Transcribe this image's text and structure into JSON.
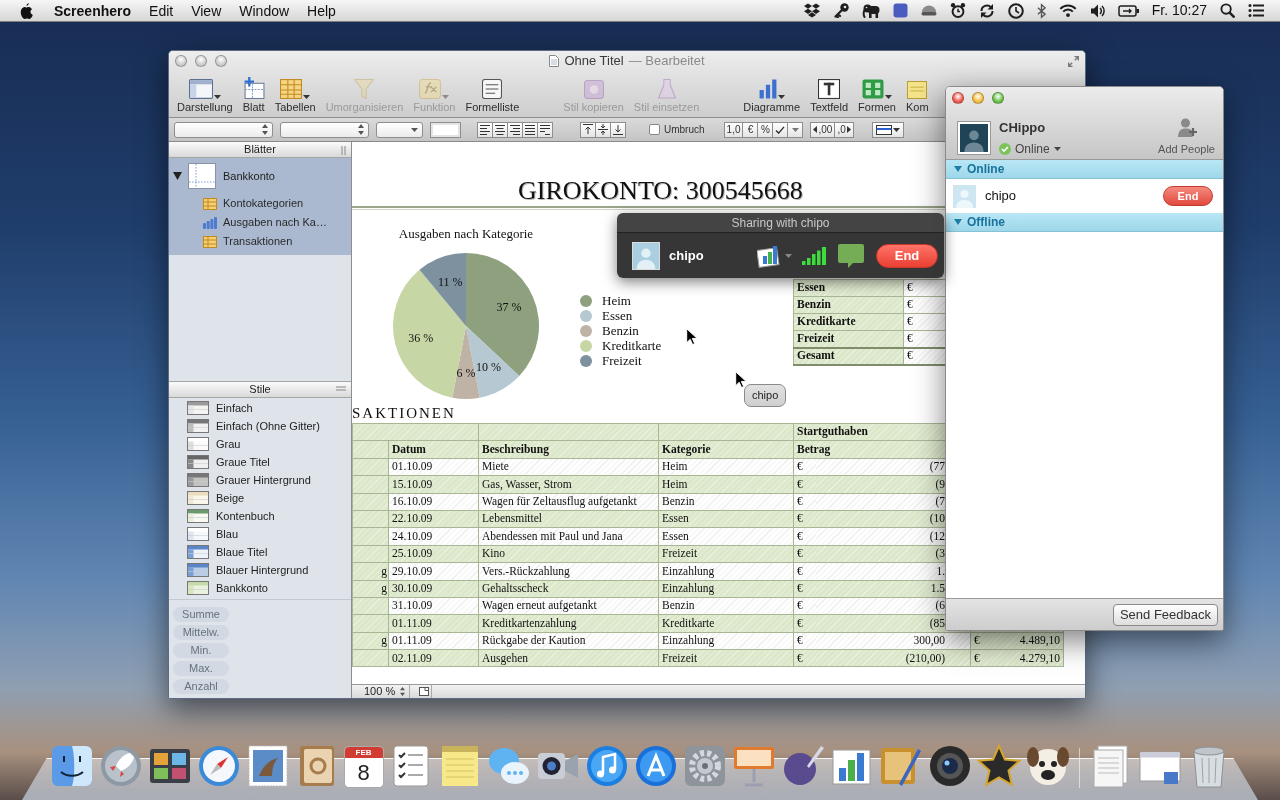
{
  "menu_bar": {
    "app": "Screenhero",
    "menus": [
      "Edit",
      "View",
      "Window",
      "Help"
    ],
    "clock": "Fr. 10:27"
  },
  "numbers_window": {
    "focused": false,
    "title": "Ohne Titel",
    "status": "— Bearbeitet",
    "toolbar": [
      {
        "kind": "view",
        "label": "Darstellung",
        "disabled": false,
        "menu": true
      },
      {
        "kind": "sheet",
        "label": "Blatt",
        "disabled": false,
        "menu": false
      },
      {
        "kind": "tables",
        "label": "Tabellen",
        "disabled": false,
        "menu": true
      },
      {
        "kind": "reorganize",
        "label": "Umorganisieren",
        "disabled": true,
        "menu": false
      },
      {
        "kind": "function",
        "label": "Funktion",
        "disabled": true,
        "menu": true
      },
      {
        "kind": "formula_list",
        "label": "Formelliste",
        "disabled": false,
        "menu": false
      },
      {
        "kind": "copy_style",
        "label": "Stil kopieren",
        "disabled": true,
        "menu": false
      },
      {
        "kind": "paste_style",
        "label": "Stil einsetzen",
        "disabled": true,
        "menu": false
      },
      {
        "kind": "charts",
        "label": "Diagramme",
        "disabled": false,
        "menu": true
      },
      {
        "kind": "textbox",
        "label": "Textfeld",
        "disabled": false,
        "menu": false
      },
      {
        "kind": "shapes",
        "label": "Formen",
        "disabled": false,
        "menu": true
      },
      {
        "kind": "comment",
        "label": "Kom",
        "disabled": false,
        "menu": false
      }
    ],
    "format_bar": {
      "wrap": {
        "label": "Umbruch",
        "checked": false
      },
      "number_formats": [
        "1,0",
        "€",
        "%"
      ],
      "decimals": [
        {
          "kind": "decrease",
          "label": ",00"
        },
        {
          "kind": "increase",
          "label": ",0"
        }
      ]
    },
    "sidebar": {
      "sheets_title": "Blätter",
      "sheets": [
        {
          "label": "Bankkonto",
          "selected": true,
          "expanded": true,
          "children": [
            {
              "kind": "table",
              "label": "Kontokategorien"
            },
            {
              "kind": "chart",
              "label": "Ausgaben nach Ka…"
            },
            {
              "kind": "table",
              "label": "Transaktionen"
            }
          ]
        }
      ],
      "styles_title": "Stile",
      "styles": [
        "Einfach",
        "Einfach (Ohne Gitter)",
        "Grau",
        "Graue Titel",
        "Grauer Hintergrund",
        "Beige",
        "Kontenbuch",
        "Blau",
        "Blaue Titel",
        "Blauer Hintergrund",
        "Bankkonto"
      ],
      "quick_formulas": [
        {
          "label": "Summe",
          "disabled": true
        },
        {
          "label": "Mittelw.",
          "disabled": true
        },
        {
          "label": "Min.",
          "disabled": true
        },
        {
          "label": "Max.",
          "disabled": true
        },
        {
          "label": "Anzahl",
          "disabled": true
        }
      ]
    },
    "canvas": {
      "title": "GIROKONTO: 300545668",
      "chart_data": {
        "type": "pie",
        "title": "Ausgaben nach Kategorie",
        "categories": [
          "Heim",
          "Essen",
          "Benzin",
          "Kreditkarte",
          "Freizeit"
        ],
        "values": [
          37,
          10,
          6,
          36,
          11
        ],
        "value_labels": [
          "37 %",
          "10 %",
          "6 %",
          "36 %",
          "11 %"
        ],
        "colors": [
          "#8ea07e",
          "#b6c8d1",
          "#bfb3a6",
          "#c7d6a5",
          "#7d919f"
        ],
        "legend": "right"
      },
      "categories_table": {
        "rows": [
          {
            "kind": "item",
            "label": "Essen",
            "currency": "€"
          },
          {
            "kind": "item",
            "label": "Benzin",
            "currency": "€"
          },
          {
            "kind": "item",
            "label": "Kreditkarte",
            "currency": "€"
          },
          {
            "kind": "item",
            "label": "Freizeit",
            "currency": "€"
          },
          {
            "kind": "total",
            "label": "Gesamt",
            "currency": "€"
          }
        ]
      },
      "transactions": {
        "title": "SAKTIONEN",
        "group_header": "Startguthaben",
        "columns": [
          "Datum",
          "Beschreibung",
          "Kategorie",
          "Betrag"
        ],
        "rows": [
          {
            "date": "01.10.09",
            "description": "Miete",
            "category": "Heim",
            "currency": "€",
            "amount": "(77"
          },
          {
            "date": "15.10.09",
            "description": "Gas, Wasser, Strom",
            "category": "Heim",
            "currency": "€",
            "amount": "(9"
          },
          {
            "date": "16.10.09",
            "description": "Wagen für Zeltausflug aufgetankt",
            "category": "Benzin",
            "currency": "€",
            "amount": "(7"
          },
          {
            "date": "22.10.09",
            "description": "Lebensmittel",
            "category": "Essen",
            "currency": "€",
            "amount": "(10"
          },
          {
            "date": "24.10.09",
            "description": "Abendessen mit Paul und Jana",
            "category": "Essen",
            "currency": "€",
            "amount": "(12"
          },
          {
            "date": "25.10.09",
            "description": "Kino",
            "category": "Freizeit",
            "currency": "€",
            "amount": "(3"
          },
          {
            "column_1": "g",
            "date": "29.10.09",
            "description": "Vers.-Rückzahlung",
            "category": "Einzahlung",
            "currency": "€",
            "amount": "1."
          },
          {
            "column_1": "g",
            "date": "30.10.09",
            "description": "Gehaltsscheck",
            "category": "Einzahlung",
            "currency": "€",
            "amount": "1.5"
          },
          {
            "date": "31.10.09",
            "description": "Wagen erneut aufgetankt",
            "category": "Benzin",
            "currency": "€",
            "amount": "(6"
          },
          {
            "date": "01.11.09",
            "description": "Kreditkartenzahlung",
            "category": "Kreditkarte",
            "currency": "€",
            "amount": "(85"
          },
          {
            "column_1": "g",
            "date": "01.11.09",
            "description": "Rückgabe der Kaution",
            "category": "Einzahlung",
            "currency": "€",
            "amount": "300,00",
            "balance_currency": "€",
            "balance": "4.489,10"
          },
          {
            "date": "02.11.09",
            "description": "Ausgehen",
            "category": "Freizeit",
            "currency": "€",
            "amount": "(210,00)",
            "balance_currency": "€",
            "balance": "4.279,10"
          }
        ]
      }
    },
    "zoom": "100 %"
  },
  "sharing_panel": {
    "title": "Sharing with chipo",
    "name": "chipo",
    "end": "End"
  },
  "cursor_label": "chipo",
  "screenhero_window": {
    "focused": true,
    "user": {
      "name": "CHippo",
      "status": "Online"
    },
    "add_people": "Add People",
    "groups": [
      {
        "label": "Online",
        "expanded": true,
        "contacts": [
          {
            "name": "chipo",
            "action": "End"
          }
        ]
      },
      {
        "label": "Offline",
        "expanded": true
      }
    ],
    "feedback": "Send Feedback"
  },
  "dock": {
    "calendar": {
      "month": "FEB",
      "day": "8"
    }
  }
}
